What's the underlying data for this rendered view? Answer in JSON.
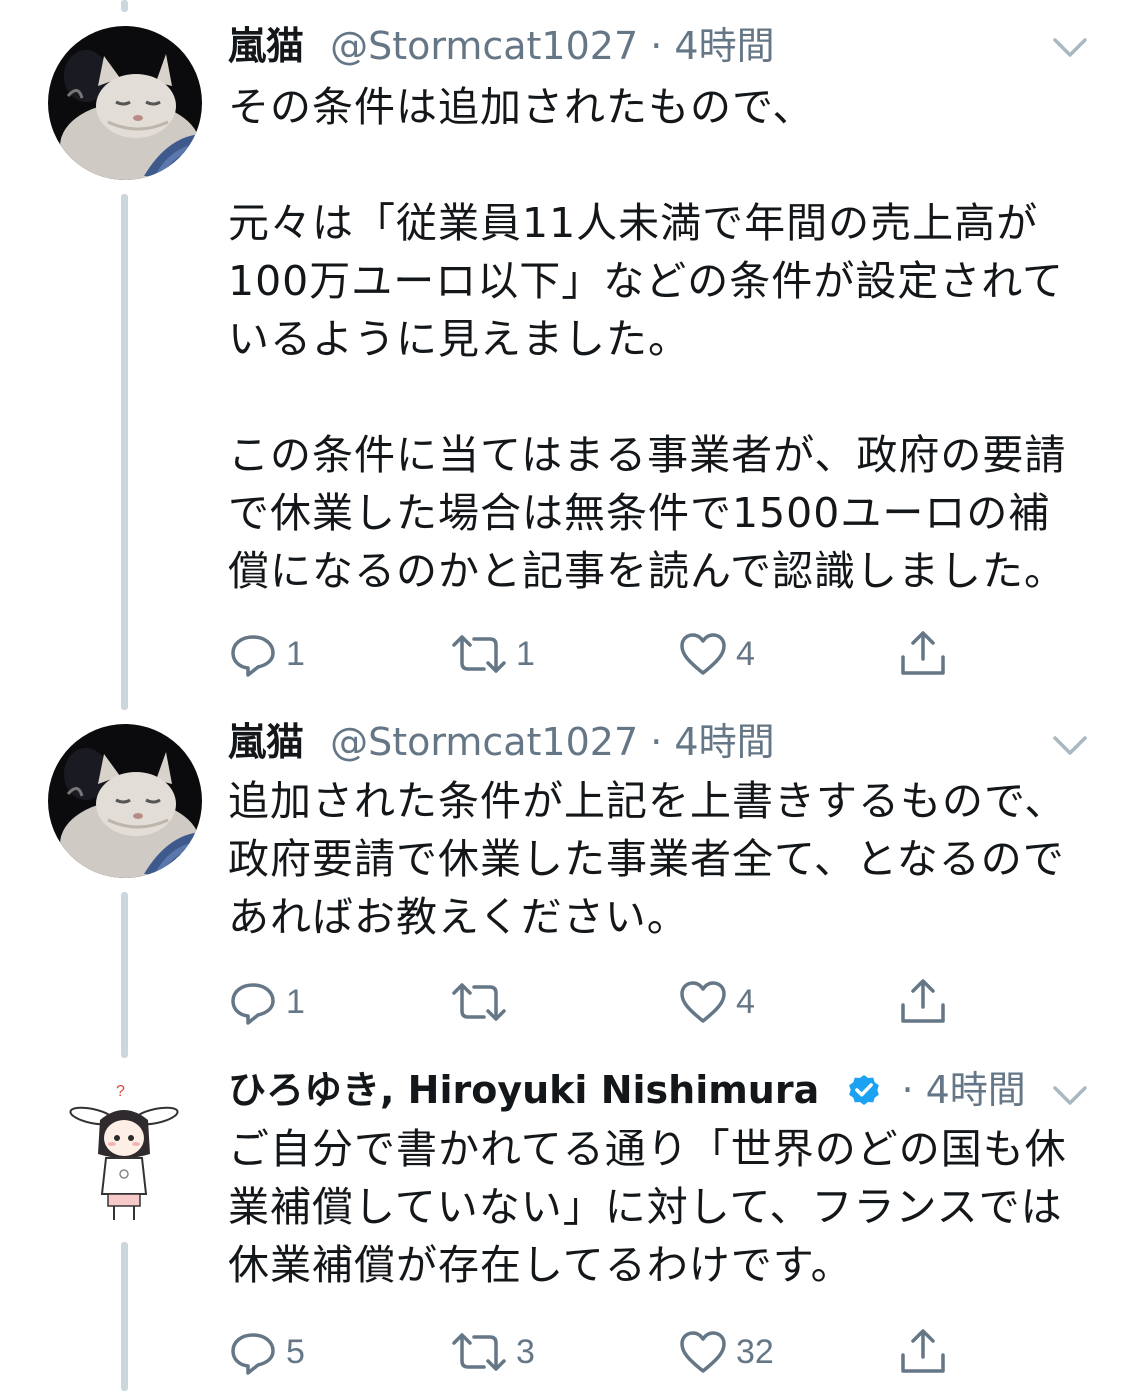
{
  "colors": {
    "text": "#14171a",
    "secondary": "#657786",
    "thread_line": "#ccd6dd",
    "verified": "#1da1f2"
  },
  "tweets": [
    {
      "display_name": "嵐猫",
      "handle": "@Stormcat1027",
      "separator": "·",
      "time": "4時間",
      "avatar": "cat-avatar",
      "paragraphs": [
        [
          "その条件は追加されたもので、"
        ],
        [
          "元々は「従業員11人未満で年間の売上高が",
          "100万ユーロ以下」などの条件が設定されて",
          "いるように見えました。"
        ],
        [
          "この条件に当てはまる事業者が、政府の要請",
          "で休業した場合は無条件で1500ユーロの補",
          "償になるのかと記事を読んで認識しました。"
        ]
      ],
      "reply_count": "1",
      "retweet_count": "1",
      "like_count": "4"
    },
    {
      "display_name": "嵐猫",
      "handle": "@Stormcat1027",
      "separator": "·",
      "time": "4時間",
      "avatar": "cat-avatar",
      "paragraphs": [
        [
          "追加された条件が上記を上書きするもので、",
          "政府要請で休業した事業者全て、となるので",
          "あればお教えください。"
        ]
      ],
      "reply_count": "1",
      "retweet_count": "",
      "like_count": "4"
    },
    {
      "display_name": "ひろゆき, Hiroyuki Nishimura",
      "handle": "",
      "verified": true,
      "separator": "·",
      "time": "4時間",
      "avatar": "bunny-girl-avatar",
      "paragraphs": [
        [
          "ご自分で書かれてる通り「世界のどの国も休",
          "業補償していない」に対して、フランスでは",
          "休業補償が存在してるわけです。"
        ]
      ],
      "reply_count": "5",
      "retweet_count": "3",
      "like_count": "32"
    }
  ]
}
